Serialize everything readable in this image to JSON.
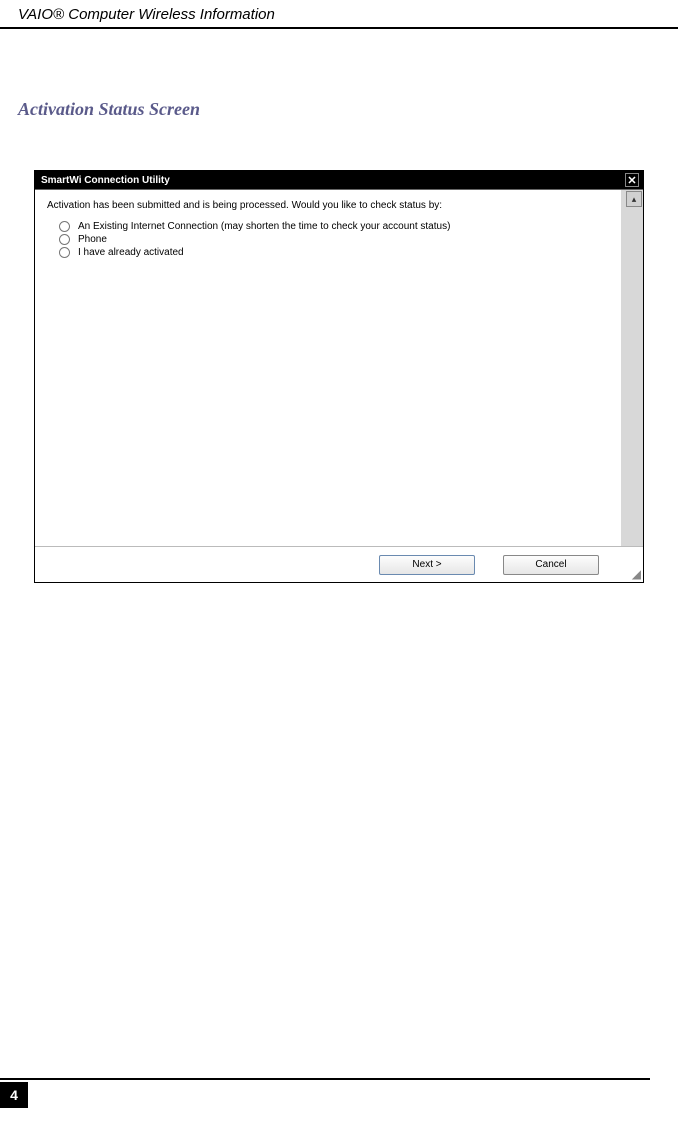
{
  "header": {
    "title": "VAIO® Computer Wireless Information"
  },
  "section": {
    "heading": "Activation Status Screen"
  },
  "dialog": {
    "title": "SmartWi Connection Utility",
    "prompt": "Activation has been submitted and is being processed. Would you like to check status by:",
    "options": [
      "An Existing Internet Connection (may shorten the time to check your account status)",
      "Phone",
      "I have already activated"
    ],
    "buttons": {
      "next": "Next >",
      "cancel": "Cancel"
    }
  },
  "page_number": "4"
}
